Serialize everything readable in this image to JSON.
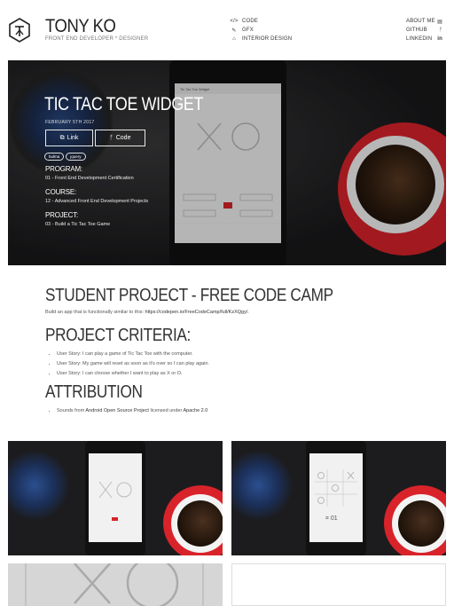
{
  "brand": {
    "name": "TONY KO",
    "subtitle": "FRONT END DEVELOPER * DESIGNER"
  },
  "nav_mid": [
    {
      "label": "CODE",
      "icon": "code-icon"
    },
    {
      "label": "GFX",
      "icon": "brush-icon"
    },
    {
      "label": "INTERIOR DESIGN",
      "icon": "building-icon"
    }
  ],
  "nav_right": [
    {
      "label": "ABOUT ME",
      "icon": "id-card-icon"
    },
    {
      "label": "GITHUB",
      "icon": "git-icon"
    },
    {
      "label": "LINKEDIN",
      "icon": "linkedin-icon"
    }
  ],
  "hero": {
    "title": "TIC TAC TOE WIDGET",
    "date": "FEBRUARY 5TH 2017",
    "link_label": "Link",
    "code_label": "Code",
    "tags": [
      "bulma",
      "jquery"
    ],
    "program_label": "PROGRAM:",
    "program_value": "01 - Front End Development Certification",
    "course_label": "COURSE:",
    "course_value": "12 - Advanced Front End Development Projects",
    "project_label": "PROJECT:",
    "project_value": "03 - Build a Tic Tac Toe Game",
    "phone_header": "Tic Tac Toe Widget"
  },
  "content": {
    "heading": "STUDENT PROJECT - FREE CODE CAMP",
    "intro_text": "Build an app that is functionally similar to this: ",
    "intro_link": "https://codepen.io/FreeCodeCamp/full/KzXQgy/",
    "criteria_heading": "PROJECT CRITERIA:",
    "criteria": [
      "User Story: I can play a game of Tic Tac Toe with the computer.",
      "User Story: My game will reset as soon as it's over so I can play again.",
      "User Story: I can choose whether I want to play as X or O."
    ],
    "attribution_heading": "ATTRIBUTION",
    "attribution": {
      "prefix": "Sounds from ",
      "link1": "Android Open Source Project",
      "middle": " licensed under ",
      "link2": "Apache 2.0"
    }
  },
  "colors": {
    "accent_red": "#d8232a",
    "text_dark": "#333333"
  }
}
